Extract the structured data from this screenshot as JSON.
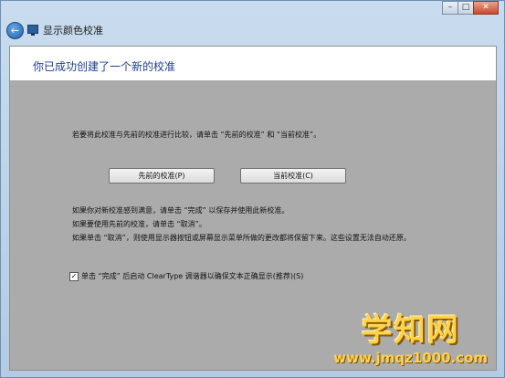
{
  "window": {
    "title": "显示颜色校准",
    "controls": {
      "minimize": "–",
      "maximize": "□",
      "close": "✕"
    }
  },
  "header": {
    "title": "你已成功创建了一个新的校准"
  },
  "main": {
    "compare_text": "若要将此校准与先前的校准进行比较，请单击 “先前的校准” 和 “当前校准”。",
    "previous_button": "先前的校准(P)",
    "current_button": "当前校准(C)",
    "info_lines": [
      "如果你对新校准感到满意，请单击 “完成” 以保存并使用此新校准。",
      "如果要使用先前的校准，请单击 “取消”。",
      "如果单击 “取消”，则使用显示器按钮或屏幕显示菜单所做的更改都将保留下来。这些设置无法自动还原。"
    ],
    "cleartype_checkbox": {
      "checked": true,
      "mark": "✓",
      "label": "单击 “完成” 后启动 ClearType 调谐器以确保文本正确显示(推荐)(S)"
    }
  },
  "watermark": {
    "logo": "学知网",
    "url": "www.jmqz1000.com"
  },
  "icons": {
    "back": "back-arrow-icon",
    "app": "display-monitor-icon"
  }
}
